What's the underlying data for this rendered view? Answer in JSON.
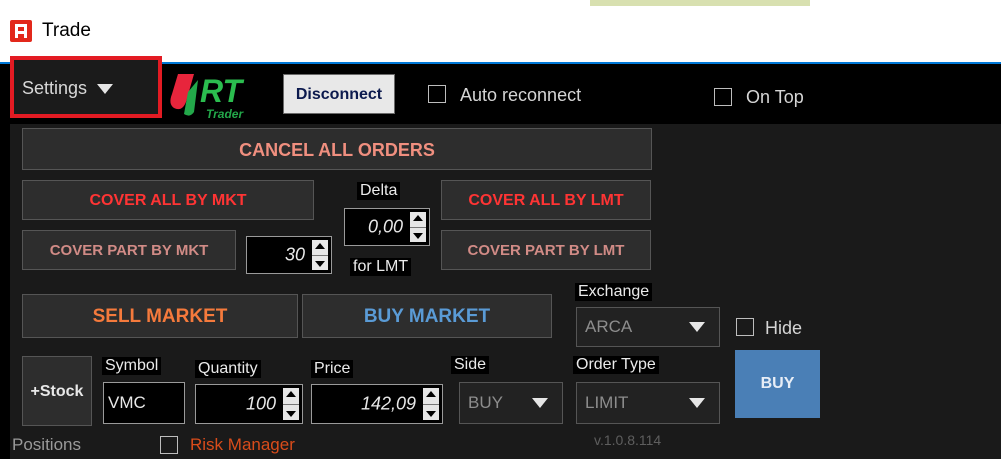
{
  "window": {
    "title": "Trade"
  },
  "toolbar": {
    "settings_label": "Settings",
    "logo_text": "RT",
    "logo_sub": "Trader",
    "disconnect_label": "Disconnect",
    "auto_reconnect_label": "Auto reconnect",
    "on_top_label": "On Top"
  },
  "actions": {
    "cancel_all": "CANCEL ALL ORDERS",
    "cover_all_mkt": "COVER ALL BY MKT",
    "cover_all_lmt": "COVER ALL BY LMT",
    "cover_part_mkt": "COVER PART BY MKT",
    "cover_part_lmt": "COVER PART BY LMT",
    "sell_market": "SELL MARKET",
    "buy_market": "BUY MARKET",
    "add_stock": "+Stock",
    "submit": "BUY"
  },
  "cover": {
    "part_quantity": "30",
    "delta_label": "Delta",
    "delta_value": "0,00",
    "for_lmt_label": "for LMT"
  },
  "exchange": {
    "label": "Exchange",
    "value": "ARCA",
    "hide_label": "Hide"
  },
  "order": {
    "symbol_label": "Symbol",
    "symbol_value": "VMC",
    "quantity_label": "Quantity",
    "quantity_value": "100",
    "price_label": "Price",
    "price_value": "142,09",
    "side_label": "Side",
    "side_value": "BUY",
    "order_type_label": "Order Type",
    "order_type_value": "LIMIT"
  },
  "status": {
    "positions_label": "Positions",
    "risk_manager_label": "Risk Manager",
    "version": "v.1.0.8.114"
  },
  "colors": {
    "settings_highlight": "#e31b23",
    "cover_text": "#ff3434",
    "sell": "#f57a3c",
    "buy_market": "#5a9bd6",
    "buy_button": "#4a7fb6",
    "risk_manager": "#d94c1a",
    "logo_red": "#e8253c",
    "logo_green": "#23a84a"
  }
}
